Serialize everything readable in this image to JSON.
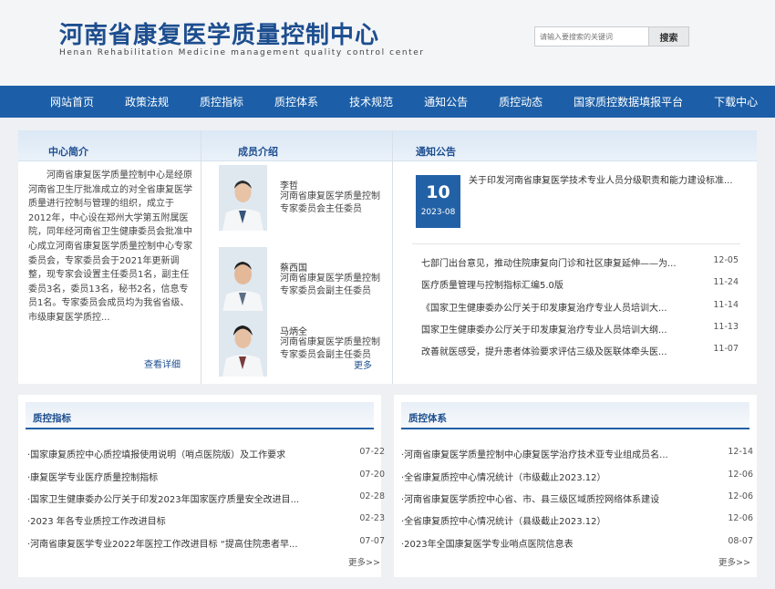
{
  "header": {
    "title_cn": "河南省康复医学质量控制中心",
    "title_en": "Henan Rehabilitation Medicine management quality control center",
    "search_placeholder": "请输入要搜索的关键词",
    "search_button": "搜索"
  },
  "nav": [
    "网站首页",
    "政策法规",
    "质控指标",
    "质控体系",
    "技术规范",
    "通知公告",
    "质控动态",
    "国家质控数据填报平台",
    "下载中心"
  ],
  "intro": {
    "title": "中心简介",
    "text": "河南省康复医学质量控制中心是经原河南省卫生厅批准成立的对全省康复医学质量进行控制与管理的组织，成立于2012年，中心设在郑州大学第五附属医院，同年经河南省卫生健康委员会批准中心成立河南省康复医学质量控制中心专家委员会，专家委员会于2021年更新调整，现专家会设置主任委员1名，副主任委员3名，委员13名，秘书2名，信息专员1名。专家委员会成员均为我省省级、市级康复医学质控...",
    "more": "查看详细"
  },
  "members": {
    "title": "成员介绍",
    "more": "更多",
    "list": [
      {
        "name": "李哲",
        "role": "河南省康复医学质量控制专家委员会主任委员"
      },
      {
        "name": "蔡西国",
        "role": "河南省康复医学质量控制专家委员会副主任委员"
      },
      {
        "name": "马炳全",
        "role": "河南省康复医学质量控制专家委员会副主任委员"
      }
    ]
  },
  "notices": {
    "title": "通知公告",
    "feature": {
      "day": "10",
      "ym": "2023-08",
      "title": "关于印发河南省康复医学技术专业人员分级职责和能力建设标准..."
    },
    "items": [
      {
        "title": "七部门出台意见，推动住院康复向门诊和社区康复延伸——为...",
        "date": "12-05"
      },
      {
        "title": "医疗质量管理与控制指标汇编5.0版",
        "date": "11-24"
      },
      {
        "title": "《国家卫生健康委办公厅关于印发康复治疗专业人员培训大...",
        "date": "11-14"
      },
      {
        "title": "国家卫生健康委办公厅关于印发康复治疗专业人员培训大纲...",
        "date": "11-13"
      },
      {
        "title": "改善就医感受，提升患者体验要求评估三级及医联体牵头医...",
        "date": "11-07"
      }
    ]
  },
  "indicators": {
    "title": "质控指标",
    "more": "更多>>",
    "items": [
      {
        "title": "·国家康复质控中心质控填报使用说明（哨点医院版）及工作要求",
        "date": "07-22"
      },
      {
        "title": "·康复医学专业医疗质量控制指标",
        "date": "07-20"
      },
      {
        "title": "·国家卫生健康委办公厅关于印发2023年国家医疗质量安全改进目...",
        "date": "02-28"
      },
      {
        "title": "·2023 年各专业质控工作改进目标",
        "date": "02-23"
      },
      {
        "title": "·河南省康复医学专业2022年医控工作改进目标 “提高住院患者早...",
        "date": "07-07"
      }
    ]
  },
  "system": {
    "title": "质控体系",
    "more": "更多>>",
    "items": [
      {
        "title": "·河南省康复医学质量控制中心康复医学治疗技术亚专业组成员名...",
        "date": "12-14"
      },
      {
        "title": "·全省康复质控中心情况统计（市级截止2023.12）",
        "date": "12-06"
      },
      {
        "title": "·河南省康复医学质控中心省、市、县三级区域质控网络体系建设",
        "date": "12-06"
      },
      {
        "title": "·全省康复质控中心情况统计（县级截止2023.12）",
        "date": "12-06"
      },
      {
        "title": "·2023年全国康复医学专业哨点医院信息表",
        "date": "08-07"
      }
    ]
  }
}
